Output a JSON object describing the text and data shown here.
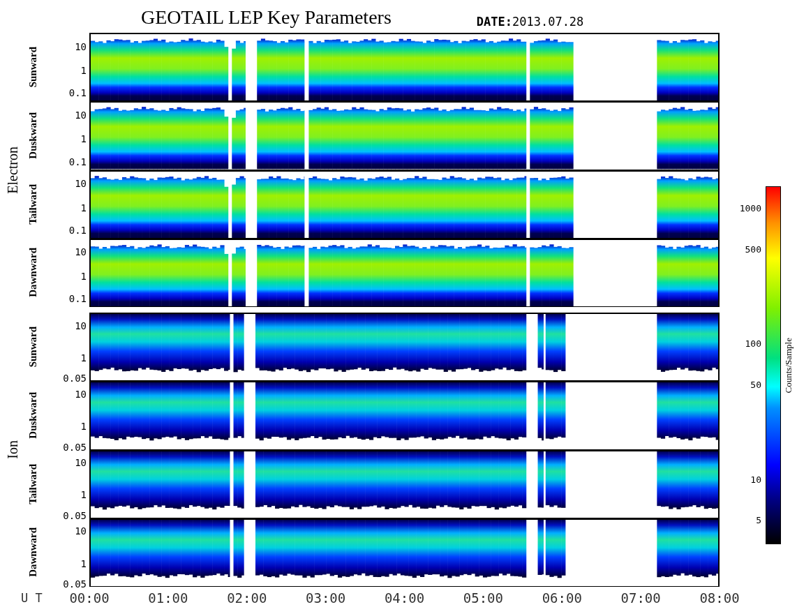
{
  "title": "GEOTAIL LEP Key Parameters",
  "date": "**DATE:**2013.07.28",
  "groups": [
    {
      "name": "Electron",
      "kind": "electron",
      "panels": [
        {
          "label": "Sunward",
          "yticks": [
            "10",
            "1",
            "0.1"
          ]
        },
        {
          "label": "Duskward",
          "yticks": [
            "10",
            "1",
            "0.1"
          ]
        },
        {
          "label": "Tailward",
          "yticks": [
            "10",
            "1",
            "0.1"
          ]
        },
        {
          "label": "Dawnward",
          "yticks": [
            "10",
            "1",
            "0.1"
          ]
        }
      ]
    },
    {
      "name": "Ion",
      "kind": "ion",
      "panels": [
        {
          "label": "Sunward",
          "yticks": [
            "10",
            "1",
            "0.05"
          ]
        },
        {
          "label": "Duskward",
          "yticks": [
            "10",
            "1",
            "0.05"
          ]
        },
        {
          "label": "Tailward",
          "yticks": [
            "10",
            "1",
            "0.05"
          ]
        },
        {
          "label": "Dawnward",
          "yticks": [
            "10",
            "1",
            "0.05"
          ]
        }
      ]
    }
  ],
  "time_axis": {
    "label": "U T",
    "ticks": [
      "00:00",
      "01:00",
      "02:00",
      "03:00",
      "04:00",
      "05:00",
      "06:00",
      "07:00",
      "08:00"
    ]
  },
  "colorbar": {
    "label": "Counts/Sample",
    "ticks": [
      "1000",
      "500",
      "100",
      "50",
      "10",
      "5"
    ]
  }
}
